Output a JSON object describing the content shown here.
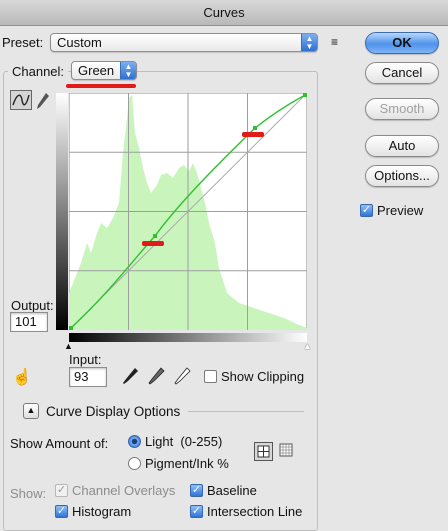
{
  "window": {
    "title": "Curves"
  },
  "preset": {
    "label": "Preset:",
    "value": "Custom"
  },
  "channel": {
    "label": "Channel:",
    "value": "Green"
  },
  "buttons": {
    "ok": "OK",
    "cancel": "Cancel",
    "smooth": "Smooth",
    "auto": "Auto",
    "options": "Options..."
  },
  "preview": {
    "label": "Preview",
    "checked": true
  },
  "output": {
    "label": "Output:",
    "value": "101"
  },
  "input": {
    "label": "Input:",
    "value": "93"
  },
  "show_clipping": {
    "label": "Show Clipping",
    "checked": false
  },
  "curve_display_options": {
    "label": "Curve Display Options"
  },
  "show_amount": {
    "label": "Show Amount of:",
    "options": [
      {
        "label": "Light  (0-255)",
        "selected": true
      },
      {
        "label": "Pigment/Ink %",
        "selected": false
      }
    ]
  },
  "show": {
    "label": "Show:",
    "channel_overlays": {
      "label": "Channel Overlays",
      "checked": true,
      "disabled": true
    },
    "baseline": {
      "label": "Baseline",
      "checked": true
    },
    "histogram": {
      "label": "Histogram",
      "checked": true
    },
    "intersection_line": {
      "label": "Intersection Line",
      "checked": true
    }
  },
  "colors": {
    "curve": "#2fc12f",
    "histogram": "#c9f5bd",
    "annotation": "#e11a1a",
    "accent": "#3a78d6"
  }
}
